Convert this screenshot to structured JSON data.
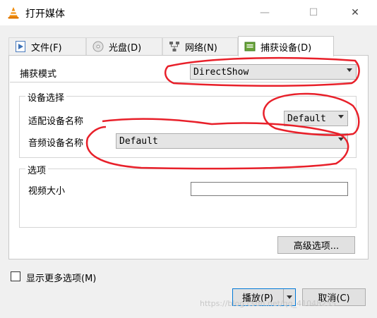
{
  "window": {
    "title": "打开媒体",
    "minimize_glyph": "—",
    "maximize_glyph": "☐",
    "close_glyph": "✕"
  },
  "tabs": [
    {
      "label": "文件(F)",
      "icon": "file-play-icon"
    },
    {
      "label": "光盘(D)",
      "icon": "disc-icon"
    },
    {
      "label": "网络(N)",
      "icon": "network-icon"
    },
    {
      "label": "捕获设备(D)",
      "icon": "capture-device-icon",
      "active": true
    }
  ],
  "capture": {
    "mode_label": "捕获模式",
    "mode_value": "DirectShow"
  },
  "device_selection": {
    "group_title": "设备选择",
    "video_label": "适配设备名称",
    "video_value": "Default",
    "audio_label": "音频设备名称",
    "audio_value": "Default"
  },
  "options": {
    "group_title": "选项",
    "video_size_label": "视频大小",
    "video_size_value": ""
  },
  "advanced_button": "高级选项...",
  "more_options": {
    "label": "显示更多选项(M)",
    "checked": false
  },
  "buttons": {
    "play": "播放(P)",
    "cancel": "取消(C)"
  },
  "watermark": "https://blog.csdn.net/qq_41048255",
  "colors": {
    "annotation_red": "#e8202a",
    "vlc_orange": "#f08a00"
  }
}
